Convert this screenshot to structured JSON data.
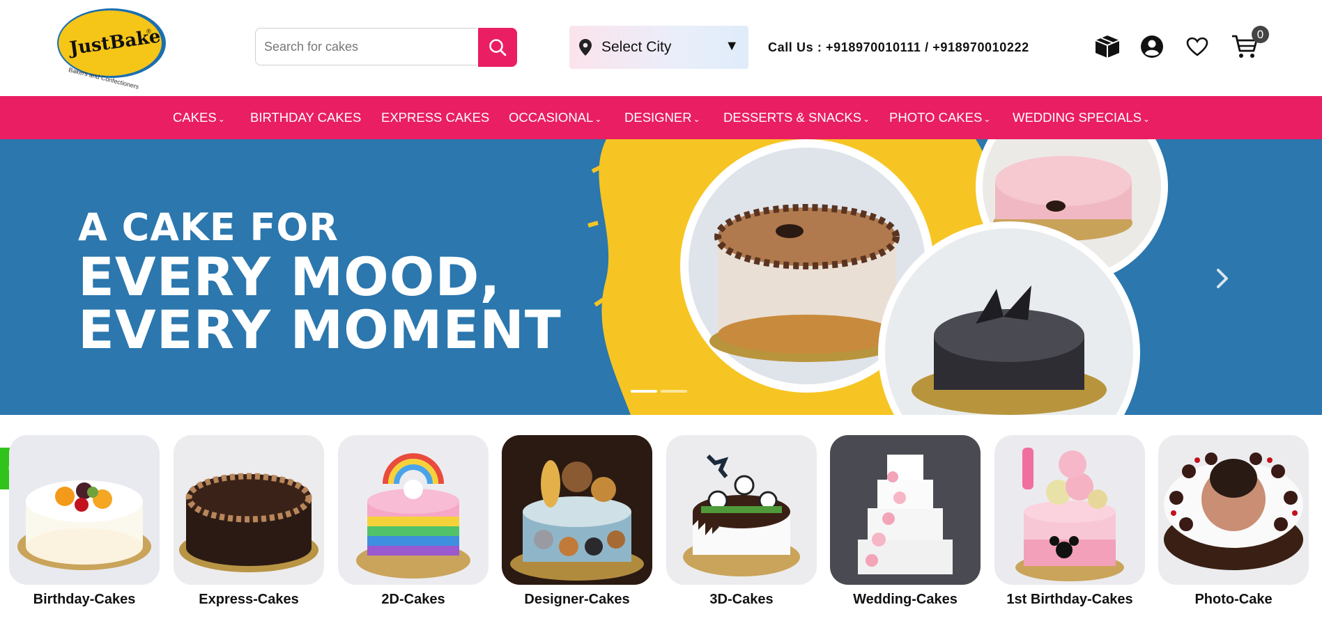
{
  "brand": {
    "name": "JustBake",
    "tagline": "Bakers and Confectioners",
    "colors": {
      "primary": "#e91e63",
      "logo_yellow": "#f5c518",
      "banner_blue": "#2b77ae",
      "whatsapp": "#2fc31c"
    }
  },
  "search": {
    "placeholder": "Search for cakes",
    "icon": "search-icon"
  },
  "city": {
    "label": "Select City",
    "caret": "▼",
    "icon": "location-pin-icon"
  },
  "contact": {
    "call_text": "Call Us : +918970010111 / +918970010222"
  },
  "header_icons": [
    {
      "name": "orders-box-icon"
    },
    {
      "name": "account-icon"
    },
    {
      "name": "wishlist-heart-icon"
    },
    {
      "name": "cart-icon"
    }
  ],
  "cart": {
    "count": "0"
  },
  "nav": {
    "items": [
      {
        "label": "CAKES",
        "dropdown": true
      },
      {
        "label": "BIRTHDAY CAKES",
        "dropdown": false
      },
      {
        "label": "EXPRESS CAKES",
        "dropdown": false
      },
      {
        "label": "OCCASIONAL",
        "dropdown": true
      },
      {
        "label": "DESIGNER",
        "dropdown": true
      },
      {
        "label": "DESSERTS & SNACKS",
        "dropdown": true
      },
      {
        "label": "PHOTO CAKES",
        "dropdown": true
      },
      {
        "label": "WEDDING SPECIALS",
        "dropdown": true
      }
    ],
    "chevron": "⌄"
  },
  "banner": {
    "line1": "A CAKE FOR",
    "line2": "EVERY MOOD,",
    "line3": "EVERY MOMENT",
    "slides": 2,
    "active_slide": 1
  },
  "categories": [
    {
      "label": "Birthday-Cakes"
    },
    {
      "label": "Express-Cakes"
    },
    {
      "label": "2D-Cakes"
    },
    {
      "label": "Designer-Cakes"
    },
    {
      "label": "3D-Cakes"
    },
    {
      "label": "Wedding-Cakes"
    },
    {
      "label": "1st Birthday-Cakes"
    },
    {
      "label": "Photo-Cake"
    }
  ]
}
